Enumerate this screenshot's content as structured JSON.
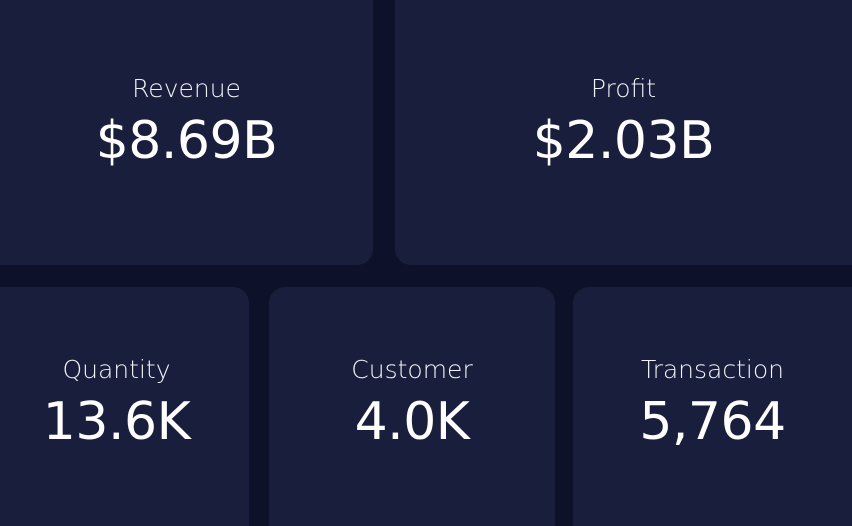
{
  "kpis": {
    "revenue": {
      "label": "Revenue",
      "value": "$8.69B"
    },
    "profit": {
      "label": "Profit",
      "value": "$2.03B"
    },
    "quantity": {
      "label": "Quantity",
      "value": "13.6K"
    },
    "customer": {
      "label": "Customer",
      "value": "4.0K"
    },
    "transaction": {
      "label": "Transaction",
      "value": "5,764"
    }
  },
  "colors": {
    "background": "#0d1129",
    "card": "#1a1e3d",
    "text": "#ffffff"
  }
}
